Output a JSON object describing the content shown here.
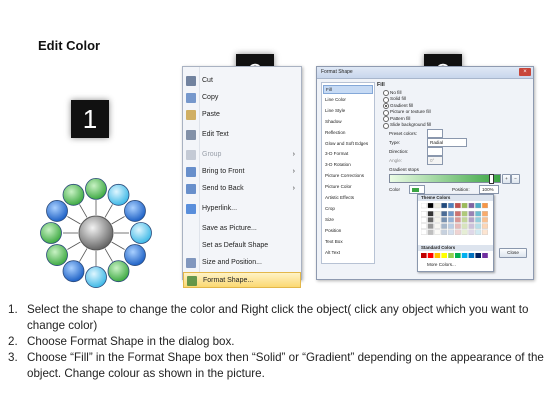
{
  "page": {
    "title": "Edit Color"
  },
  "badges": [
    "1",
    "2",
    "3"
  ],
  "context_menu": {
    "items": [
      {
        "label": "Cut",
        "icon": "scissors-icon",
        "disabled": false,
        "arrow": false
      },
      {
        "label": "Copy",
        "icon": "copy-icon",
        "disabled": false,
        "arrow": false
      },
      {
        "label": "Paste",
        "icon": "paste-icon",
        "disabled": false,
        "arrow": false
      },
      {
        "label": "Edit Text",
        "icon": "edit-text-icon",
        "disabled": false,
        "arrow": false
      },
      {
        "label": "Group",
        "icon": "group-icon",
        "disabled": true,
        "arrow": true
      },
      {
        "label": "Bring to Front",
        "icon": "bring-front-icon",
        "disabled": false,
        "arrow": true
      },
      {
        "label": "Send to Back",
        "icon": "send-back-icon",
        "disabled": false,
        "arrow": true
      },
      {
        "label": "Hyperlink...",
        "icon": "hyperlink-icon",
        "disabled": false,
        "arrow": false
      },
      {
        "label": "Save as Picture...",
        "icon": "",
        "disabled": false,
        "arrow": false
      },
      {
        "label": "Set as Default Shape",
        "icon": "",
        "disabled": false,
        "arrow": false
      },
      {
        "label": "Size and Position...",
        "icon": "size-position-icon",
        "disabled": false,
        "arrow": false
      },
      {
        "label": "Format Shape...",
        "icon": "format-shape-icon",
        "disabled": false,
        "arrow": false
      }
    ],
    "highlighted": "Format Shape..."
  },
  "dialog": {
    "title": "Format Shape",
    "close": "×",
    "nav": [
      "Fill",
      "Line Color",
      "Line Style",
      "Shadow",
      "Reflection",
      "Glow and Soft Edges",
      "3-D Format",
      "3-D Rotation",
      "Picture Corrections",
      "Picture Color",
      "Artistic Effects",
      "Crop",
      "Size",
      "Position",
      "Text Box",
      "Alt Text"
    ],
    "selected_nav": "Fill",
    "panel": {
      "heading": "Fill",
      "options": [
        "No fill",
        "Solid fill",
        "Gradient fill",
        "Picture or texture fill",
        "Pattern fill",
        "Slide background fill"
      ],
      "selected_option": "Gradient fill",
      "preset_colors": "Preset colors:",
      "type_label": "Type:",
      "type_value": "Radial",
      "direction_label": "Direction:",
      "angle_label": "Angle:",
      "angle_value": "0°",
      "gradient_stops": "Gradient stops",
      "color_label": "Color",
      "position_label": "Position:",
      "position_value": "100%",
      "brightness_label": "Brightness:",
      "transparency_label": "Transparen",
      "rotate_label": "Rotate",
      "theme_colors": "Theme Colors",
      "standard_colors": "Standard Colors",
      "more_colors": "More Colors...",
      "close_button": "Close"
    }
  },
  "instructions": [
    {
      "num": "1.",
      "text": "Select the shape to change the color and Right click the object( click any object which you want to change color)"
    },
    {
      "num": "2.",
      "text": "Choose Format Shape in the dialog box."
    },
    {
      "num": "3.",
      "text": "Choose “Fill” in the Format Shape box then “Solid” or “Gradient” depending on the appearance of the object. Change colour as shown in the picture."
    }
  ],
  "colors": {
    "green": "#58c25c",
    "blue": "#2f78d8",
    "light_blue": "#6fd0f2",
    "center": "#8e8e8e",
    "highlight": "#fbd872"
  }
}
